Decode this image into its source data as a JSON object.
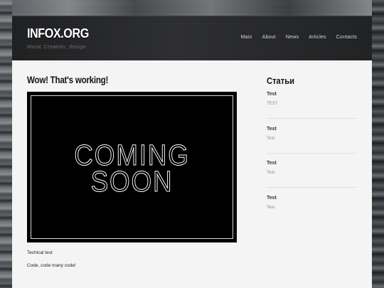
{
  "header": {
    "logo": "INFOX.ORG",
    "tagline": "Music Creation, design",
    "nav": [
      "Main",
      "About",
      "News",
      "Articles",
      "Contacts"
    ]
  },
  "post": {
    "title": "Wow! That's working!",
    "image_text_line1": "COMING",
    "image_text_line2": "SOON",
    "paragraphs": [
      "Techical test",
      "Code, code many code!"
    ]
  },
  "sidebar": {
    "title": "Статьи",
    "items": [
      {
        "title": "Test",
        "excerpt": "TEST"
      },
      {
        "title": "Test",
        "excerpt": "Test"
      },
      {
        "title": "Test",
        "excerpt": "Test"
      },
      {
        "title": "Test",
        "excerpt": "Test"
      }
    ]
  }
}
